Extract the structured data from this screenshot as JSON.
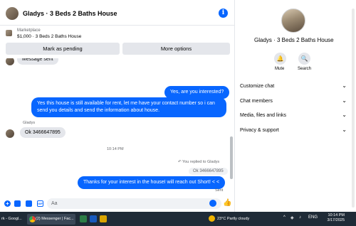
{
  "chat": {
    "title": "Gladys · 3 Beds 2 Baths House",
    "marketplace_label": "Marketplace",
    "listing": "$1,000 · 3 Beds 2 Baths House",
    "buttons": {
      "pending": "Mark as pending",
      "more": "More options"
    }
  },
  "messages": {
    "partial_top": "Message sent",
    "out1": "Yes, are you interested?",
    "out2_line1": "Yes this house is still available for rent, let me have your contact number so i can",
    "out2_line2": "send you details and send the information about house.",
    "sender_name": "Gladys",
    "in1": "Ok 3466647895",
    "time": "10:14 PM",
    "replied_to": "You replied to Gladys",
    "quoted": "Ok 3466647895",
    "out3": "Thanks for your interest in the houseI will reach out Short! < <",
    "status": "Sent"
  },
  "composer": {
    "placeholder": "Aa"
  },
  "sidebar": {
    "title": "Gladys · 3 Beds 2 Baths House",
    "mute": "Mute",
    "search": "Search",
    "rows": [
      {
        "label": "Customize chat"
      },
      {
        "label": "Chat members"
      },
      {
        "label": "Media, files and links"
      },
      {
        "label": "Privacy & support"
      }
    ]
  },
  "taskbar": {
    "app1": "rk - Googl...",
    "app2": "(2) Messenger | Fac...",
    "weather": "23°C  Partly cloudy",
    "lang": "ENG",
    "time": "10:14 PM",
    "date": "3/17/2025"
  },
  "colors": {
    "accent": "#0866ff",
    "bubble_in": "#e4e6eb",
    "taskbar": "#1f2b37"
  }
}
